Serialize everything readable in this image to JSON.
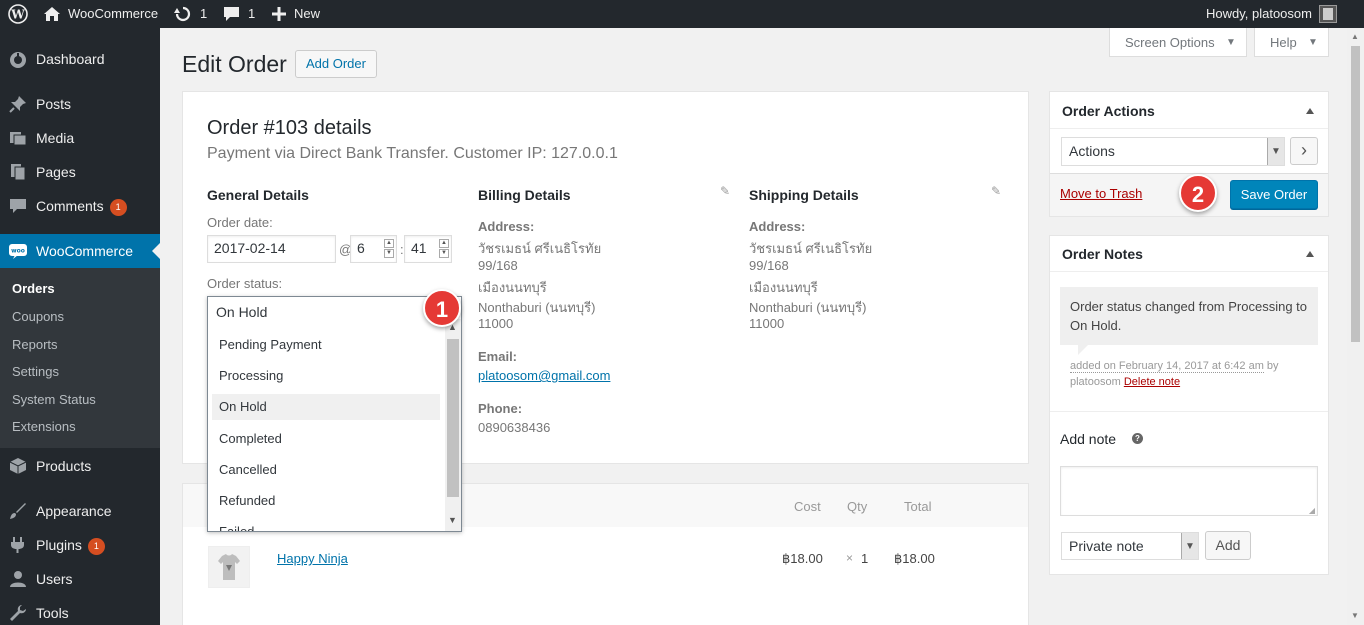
{
  "admin_bar": {
    "site_name": "WooCommerce",
    "updates_count": "1",
    "comments_count": "1",
    "new_label": "New",
    "greeting": "Howdy, platoosom"
  },
  "sidebar": {
    "items": [
      {
        "label": "Dashboard",
        "icon": "dashboard-icon"
      },
      {
        "label": "Posts",
        "icon": "pin-icon"
      },
      {
        "label": "Media",
        "icon": "media-icon"
      },
      {
        "label": "Pages",
        "icon": "pages-icon"
      },
      {
        "label": "Comments",
        "icon": "comment-icon",
        "badge": "1"
      },
      {
        "label": "WooCommerce",
        "icon": "woo-icon"
      },
      {
        "label": "Products",
        "icon": "box-icon"
      },
      {
        "label": "Appearance",
        "icon": "brush-icon"
      },
      {
        "label": "Plugins",
        "icon": "plug-icon",
        "badge": "1"
      },
      {
        "label": "Users",
        "icon": "user-icon"
      },
      {
        "label": "Tools",
        "icon": "wrench-icon"
      }
    ],
    "submenu": [
      "Orders",
      "Coupons",
      "Reports",
      "Settings",
      "System Status",
      "Extensions"
    ]
  },
  "header": {
    "title": "Edit Order",
    "add_order": "Add Order",
    "screen_options": "Screen Options",
    "help": "Help"
  },
  "order": {
    "title": "Order #103 details",
    "subtitle": "Payment via Direct Bank Transfer. Customer IP: 127.0.0.1",
    "general_heading": "General Details",
    "order_date_label": "Order date:",
    "date_value": "2017-02-14",
    "at_sign": "@",
    "hour": "6",
    "colon": ":",
    "minute": "41",
    "status_label": "Order status:",
    "status_current": "On Hold",
    "status_options": [
      "Pending Payment",
      "Processing",
      "On Hold",
      "Completed",
      "Cancelled",
      "Refunded",
      "Failed"
    ],
    "billing": {
      "heading": "Billing Details",
      "address_label": "Address:",
      "address_lines": [
        "วัชรเมธน์ ศรีเนธิโรทัย",
        "99/168",
        "เมืองนนทบุรี",
        "Nonthaburi (นนทบุรี)",
        "11000"
      ],
      "email_label": "Email:",
      "email": "platoosom@gmail.com",
      "phone_label": "Phone:",
      "phone": "0890638436"
    },
    "shipping": {
      "heading": "Shipping Details",
      "address_label": "Address:",
      "address_lines": [
        "วัชรเมธน์ ศรีเนธิโรทัย",
        "99/168",
        "เมืองนนทบุรี",
        "Nonthaburi (นนทบุรี)",
        "11000"
      ]
    }
  },
  "items_table": {
    "headers": [
      "Cost",
      "Qty",
      "Total"
    ],
    "rows": [
      {
        "name": "Happy Ninja",
        "cost": "฿18.00",
        "qty_prefix": "×",
        "qty": "1",
        "total": "฿18.00"
      }
    ]
  },
  "order_actions": {
    "title": "Order Actions",
    "select_value": "Actions",
    "go": "›",
    "trash": "Move to Trash",
    "save": "Save Order"
  },
  "order_notes": {
    "title": "Order Notes",
    "note_text": "Order status changed from Processing to On Hold.",
    "meta_added": "added on February 14, 2017 at 6:42 am",
    "meta_by": "by",
    "meta_author": "platoosom",
    "delete": "Delete note",
    "add_note_label": "Add note",
    "help": "?",
    "note_type": "Private note",
    "add_button": "Add"
  },
  "callouts": [
    "1",
    "2"
  ],
  "colors": {
    "admin_bg": "#23282d",
    "accent": "#0073aa",
    "primary_button": "#0085ba",
    "badge": "#d54e21",
    "callout": "#e53935",
    "trash": "#aa0000"
  }
}
